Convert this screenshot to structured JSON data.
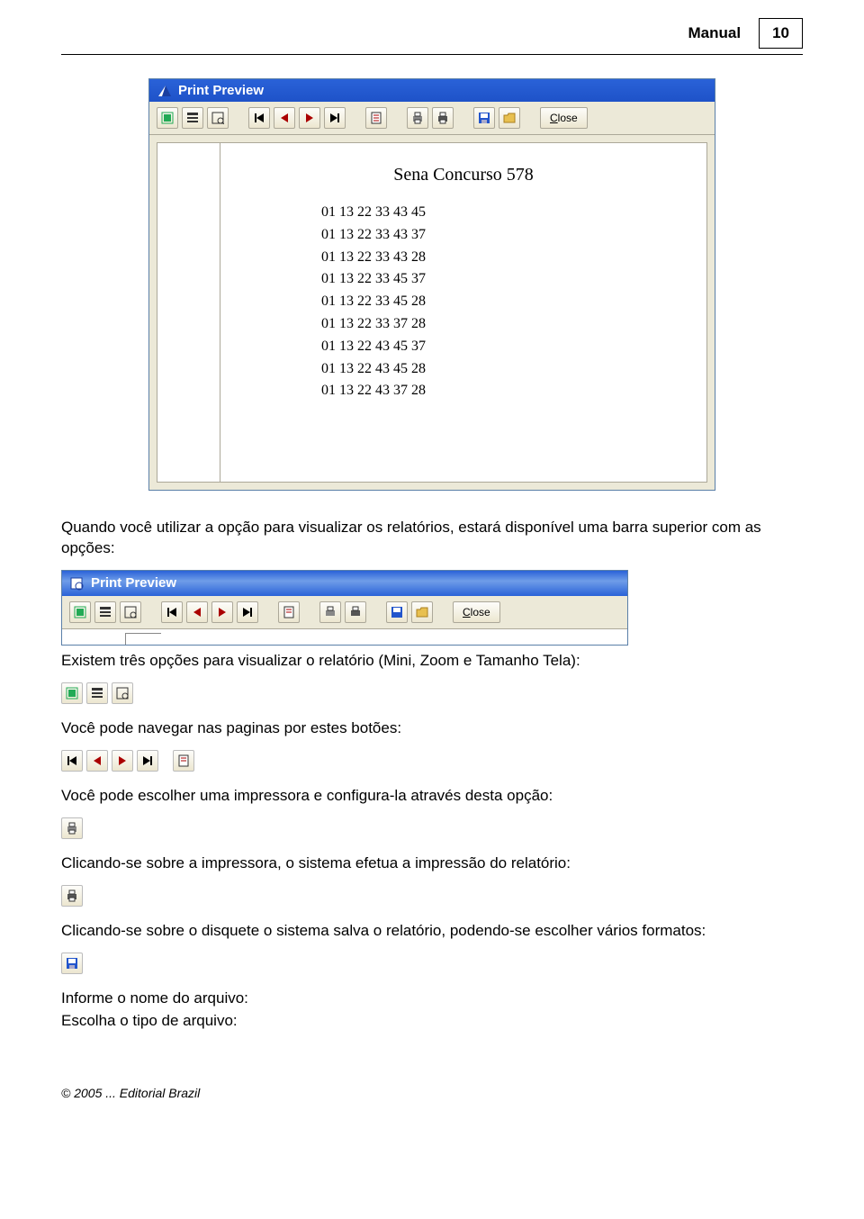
{
  "header": {
    "label": "Manual",
    "page": "10"
  },
  "window": {
    "title": "Print Preview",
    "close_label": "Close",
    "preview_title": "Sena Concurso 578",
    "lines": [
      "01 13 22 33 43 45",
      "01 13 22 33 43 37",
      "01 13 22 33 43 28",
      "01 13 22 33 45 37",
      "01 13 22 33 45 28",
      "01 13 22 33 37 28",
      "01 13 22 43 45 37",
      "01 13 22 43 45 28",
      "01 13 22 43 37 28"
    ]
  },
  "text": {
    "p1": "Quando você utilizar a opção para visualizar os relatórios, estará disponível uma barra superior com as opções:",
    "p2": "Existem três opções para visualizar o relatório (Mini, Zoom e Tamanho Tela):",
    "p3": "Você pode navegar nas paginas por estes botões:",
    "p4": "Você pode escolher uma impressora e configura-la através desta opção:",
    "p5": "Clicando-se sobre a impressora, o sistema efetua a impressão do relatório:",
    "p6": "Clicando-se sobre o disquete o sistema salva o relatório, podendo-se escolher vários formatos:",
    "p7": "Informe o nome do arquivo:",
    "p8": "Escolha o tipo de arquivo:"
  },
  "small_window": {
    "title": "Print Preview",
    "close_label": "Close"
  },
  "footer": "© 2005 ... Editorial Brazil"
}
